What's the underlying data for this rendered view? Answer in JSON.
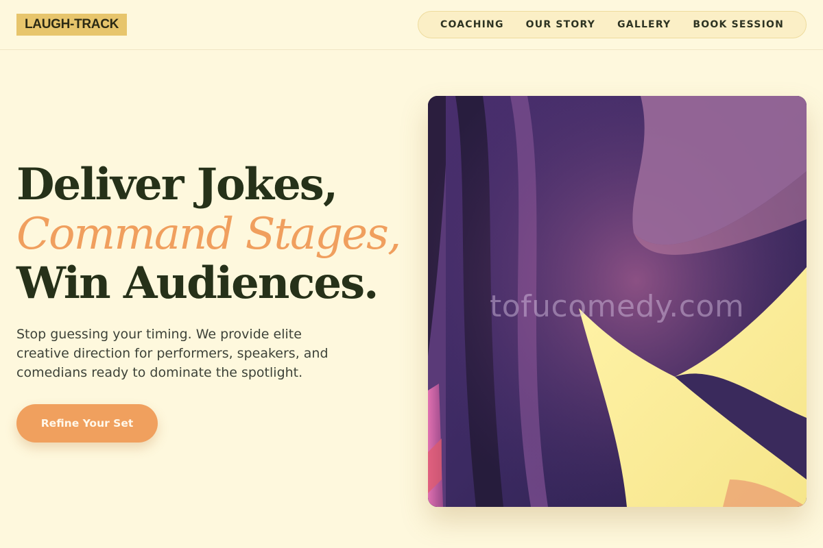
{
  "header": {
    "logo": "LAUGH-TRACK",
    "nav": [
      "COACHING",
      "OUR STORY",
      "GALLERY",
      "BOOK SESSION"
    ]
  },
  "hero": {
    "headline_line1": "Deliver Jokes,",
    "headline_line2": "Command Stages,",
    "headline_line3": "Win Audiences.",
    "subtext": "Stop guessing your timing. We provide elite creative direction for performers, speakers, and comedians ready to dominate the spotlight.",
    "cta_label": "Refine Your Set",
    "image_watermark": "tofucomedy.com"
  },
  "colors": {
    "background": "#fef8dd",
    "logo_bg": "#e7c56c",
    "accent": "#f09f5e",
    "heading": "#263119"
  }
}
